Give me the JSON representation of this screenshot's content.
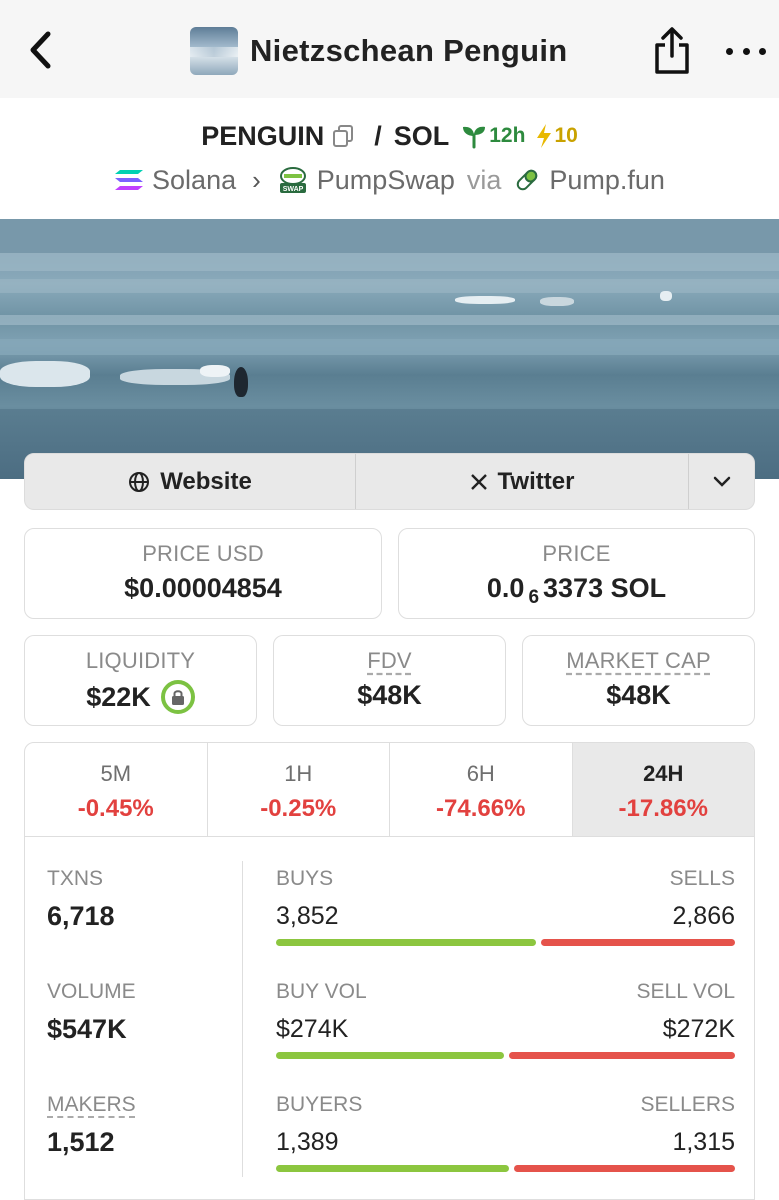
{
  "nav": {
    "title": "Nietzschean Penguin"
  },
  "pair": {
    "base": "PENGUIN",
    "separator": "/",
    "quote": "SOL",
    "age": "12h",
    "boosts": "10"
  },
  "chain": {
    "network": "Solana",
    "dex": "PumpSwap",
    "via": "via",
    "launchpad": "Pump.fun",
    "dex_badge": "SWAP"
  },
  "links": {
    "website": "Website",
    "twitter": "Twitter"
  },
  "price": {
    "usd_label": "PRICE USD",
    "usd_value": "$0.00004854",
    "native_label": "PRICE",
    "native_prefix": "0.0",
    "native_sub": "6",
    "native_suffix": "3373 SOL"
  },
  "metrics": {
    "liquidity_label": "LIQUIDITY",
    "liquidity_value": "$22K",
    "fdv_label": "FDV",
    "fdv_value": "$48K",
    "mcap_label": "MARKET CAP",
    "mcap_value": "$48K"
  },
  "tabs": [
    {
      "label": "5M",
      "change": "-0.45%"
    },
    {
      "label": "1H",
      "change": "-0.25%"
    },
    {
      "label": "6H",
      "change": "-74.66%"
    },
    {
      "label": "24H",
      "change": "-17.86%"
    }
  ],
  "stats": {
    "txns_label": "TXNS",
    "txns_value": "6,718",
    "volume_label": "VOLUME",
    "volume_value": "$547K",
    "makers_label": "MAKERS",
    "makers_value": "1,512",
    "buys_label": "BUYS",
    "buys_value": "3,852",
    "sells_label": "SELLS",
    "sells_value": "2,866",
    "buyvol_label": "BUY VOL",
    "buyvol_value": "$274K",
    "sellvol_label": "SELL VOL",
    "sellvol_value": "$272K",
    "buyers_label": "BUYERS",
    "buyers_value": "1,389",
    "sellers_label": "SELLERS",
    "sellers_value": "1,315",
    "buy_ratio_txns": 0.573,
    "buy_ratio_vol": 0.502,
    "buy_ratio_makers": 0.514
  },
  "colors": {
    "buy": "#8cc63f",
    "sell": "#e5534b",
    "negative": "#e2413f",
    "age": "#2d8a3e",
    "boost": "#c9a200"
  }
}
